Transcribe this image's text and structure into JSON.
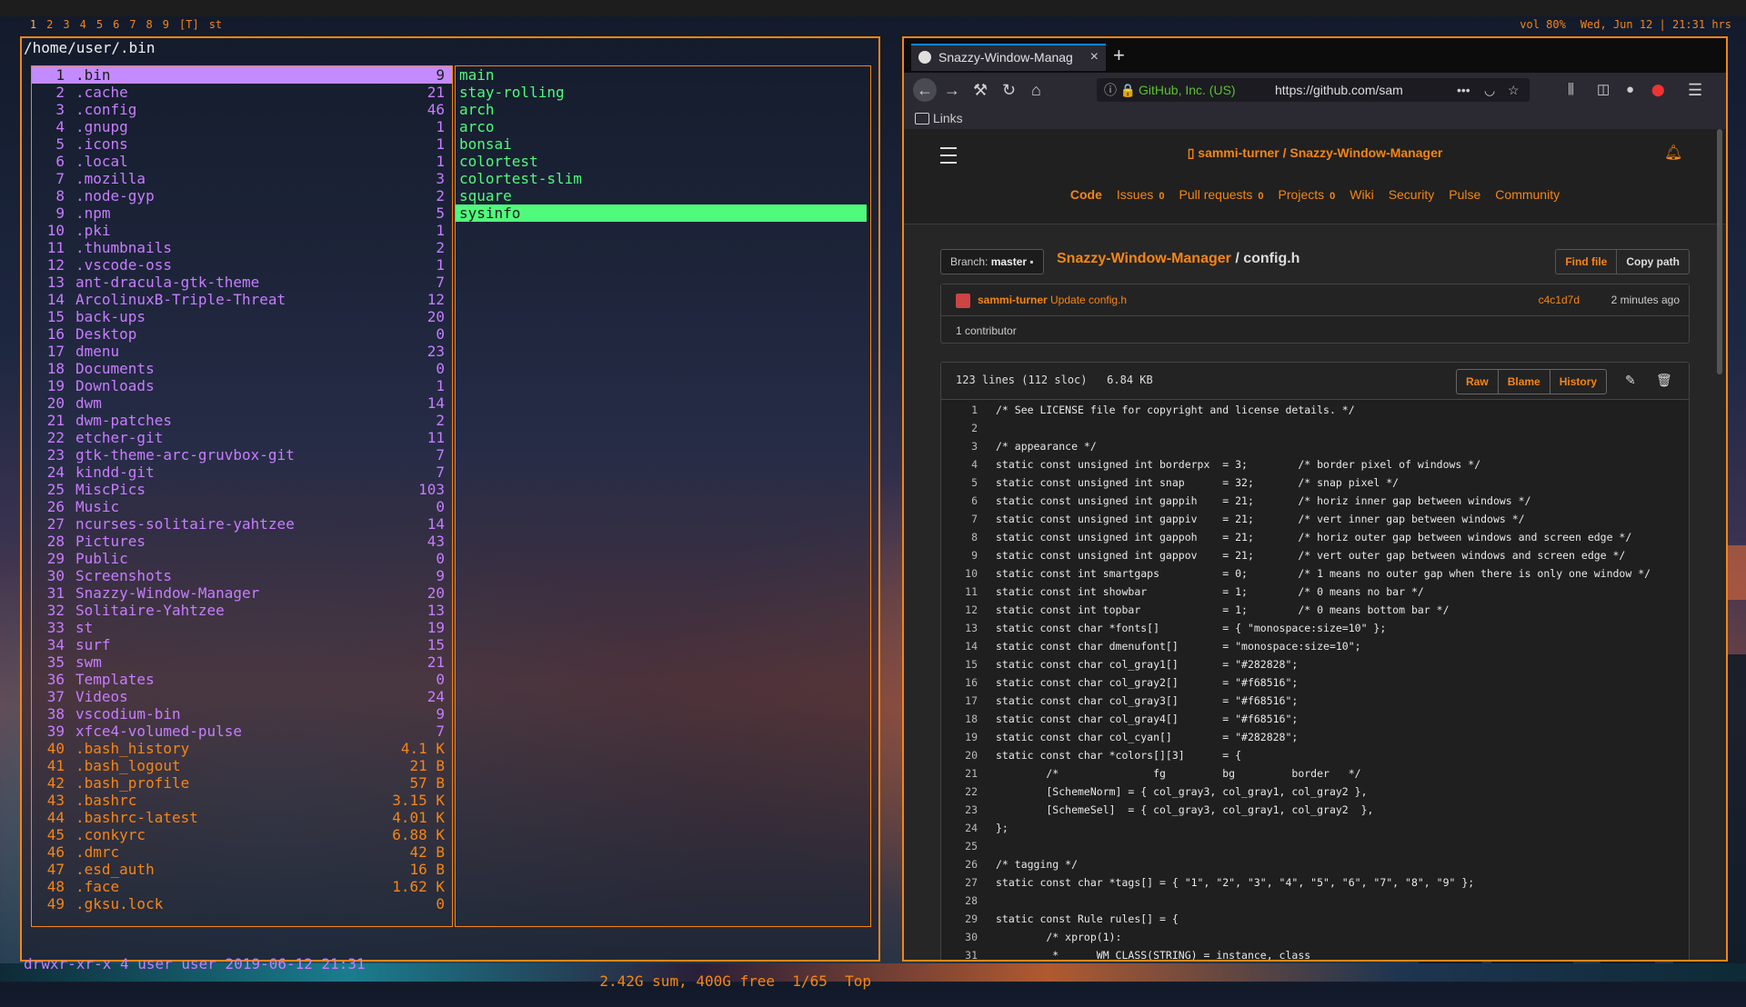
{
  "topbar": {
    "tags": [
      "1",
      "2",
      "3",
      "4",
      "5",
      "6",
      "7",
      "8",
      "9"
    ],
    "layout": "[T]",
    "window": "st",
    "volume": "vol 80%",
    "datetime": "Wed, Jun 12 | 21:31 hrs"
  },
  "terminal": {
    "path": "/home/user/.bin",
    "left_pane": [
      {
        "num": "1",
        "name": ".bin",
        "size": "9",
        "type": "dir",
        "selected": true
      },
      {
        "num": "2",
        "name": ".cache",
        "size": "21",
        "type": "dir"
      },
      {
        "num": "3",
        "name": ".config",
        "size": "46",
        "type": "dir"
      },
      {
        "num": "4",
        "name": ".gnupg",
        "size": "1",
        "type": "dir"
      },
      {
        "num": "5",
        "name": ".icons",
        "size": "1",
        "type": "dir"
      },
      {
        "num": "6",
        "name": ".local",
        "size": "1",
        "type": "dir"
      },
      {
        "num": "7",
        "name": ".mozilla",
        "size": "3",
        "type": "dir"
      },
      {
        "num": "8",
        "name": ".node-gyp",
        "size": "2",
        "type": "dir"
      },
      {
        "num": "9",
        "name": ".npm",
        "size": "5",
        "type": "dir"
      },
      {
        "num": "10",
        "name": ".pki",
        "size": "1",
        "type": "dir"
      },
      {
        "num": "11",
        "name": ".thumbnails",
        "size": "2",
        "type": "dir"
      },
      {
        "num": "12",
        "name": ".vscode-oss",
        "size": "1",
        "type": "dir"
      },
      {
        "num": "13",
        "name": "ant-dracula-gtk-theme",
        "size": "7",
        "type": "dir"
      },
      {
        "num": "14",
        "name": "ArcolinuxB-Triple-Threat",
        "size": "12",
        "type": "dir"
      },
      {
        "num": "15",
        "name": "back-ups",
        "size": "20",
        "type": "dir"
      },
      {
        "num": "16",
        "name": "Desktop",
        "size": "0",
        "type": "dir"
      },
      {
        "num": "17",
        "name": "dmenu",
        "size": "23",
        "type": "dir"
      },
      {
        "num": "18",
        "name": "Documents",
        "size": "0",
        "type": "dir"
      },
      {
        "num": "19",
        "name": "Downloads",
        "size": "1",
        "type": "dir"
      },
      {
        "num": "20",
        "name": "dwm",
        "size": "14",
        "type": "dir"
      },
      {
        "num": "21",
        "name": "dwm-patches",
        "size": "2",
        "type": "dir"
      },
      {
        "num": "22",
        "name": "etcher-git",
        "size": "11",
        "type": "dir"
      },
      {
        "num": "23",
        "name": "gtk-theme-arc-gruvbox-git",
        "size": "7",
        "type": "dir"
      },
      {
        "num": "24",
        "name": "kindd-git",
        "size": "7",
        "type": "dir"
      },
      {
        "num": "25",
        "name": "MiscPics",
        "size": "103",
        "type": "dir"
      },
      {
        "num": "26",
        "name": "Music",
        "size": "0",
        "type": "dir"
      },
      {
        "num": "27",
        "name": "ncurses-solitaire-yahtzee",
        "size": "14",
        "type": "dir"
      },
      {
        "num": "28",
        "name": "Pictures",
        "size": "43",
        "type": "dir"
      },
      {
        "num": "29",
        "name": "Public",
        "size": "0",
        "type": "dir"
      },
      {
        "num": "30",
        "name": "Screenshots",
        "size": "9",
        "type": "dir"
      },
      {
        "num": "31",
        "name": "Snazzy-Window-Manager",
        "size": "20",
        "type": "dir"
      },
      {
        "num": "32",
        "name": "Solitaire-Yahtzee",
        "size": "13",
        "type": "dir"
      },
      {
        "num": "33",
        "name": "st",
        "size": "19",
        "type": "dir"
      },
      {
        "num": "34",
        "name": "surf",
        "size": "15",
        "type": "dir"
      },
      {
        "num": "35",
        "name": "swm",
        "size": "21",
        "type": "dir"
      },
      {
        "num": "36",
        "name": "Templates",
        "size": "0",
        "type": "dir"
      },
      {
        "num": "37",
        "name": "Videos",
        "size": "24",
        "type": "dir"
      },
      {
        "num": "38",
        "name": "vscodium-bin",
        "size": "9",
        "type": "dir"
      },
      {
        "num": "39",
        "name": "xfce4-volumed-pulse",
        "size": "7",
        "type": "dir"
      },
      {
        "num": "40",
        "name": ".bash_history",
        "size": "4.1 K",
        "type": "file"
      },
      {
        "num": "41",
        "name": ".bash_logout",
        "size": "21 B",
        "type": "file"
      },
      {
        "num": "42",
        "name": ".bash_profile",
        "size": "57 B",
        "type": "file"
      },
      {
        "num": "43",
        "name": ".bashrc",
        "size": "3.15 K",
        "type": "file"
      },
      {
        "num": "44",
        "name": ".bashrc-latest",
        "size": "4.01 K",
        "type": "file"
      },
      {
        "num": "45",
        "name": ".conkyrc",
        "size": "6.88 K",
        "type": "file"
      },
      {
        "num": "46",
        "name": ".dmrc",
        "size": "42 B",
        "type": "file"
      },
      {
        "num": "47",
        "name": ".esd_auth",
        "size": "16 B",
        "type": "file"
      },
      {
        "num": "48",
        "name": ".face",
        "size": "1.62 K",
        "type": "file"
      },
      {
        "num": "49",
        "name": ".gksu.lock",
        "size": "0",
        "type": "file"
      }
    ],
    "right_pane": [
      {
        "name": "main"
      },
      {
        "name": "stay-rolling"
      },
      {
        "name": "arch"
      },
      {
        "name": "arco"
      },
      {
        "name": "bonsai"
      },
      {
        "name": "colortest"
      },
      {
        "name": "colortest-slim"
      },
      {
        "name": "square"
      },
      {
        "name": "sysinfo",
        "selected": true
      }
    ],
    "status_perm": "drwxr-xr-x 4 user user 2019-06-12 21:31",
    "status_info": "2.42G sum, 400G free  1/65  Top"
  },
  "browser": {
    "tab_title": "Snazzy-Window-Manag",
    "tab_close": "×",
    "new_tab": "+",
    "url_org": "GitHub, Inc. (US)",
    "url": "https://github.com/sam",
    "bookmark": "Links",
    "colors": {
      "accent": "#f68516",
      "bg": "#262626",
      "tab_accent": "#0a84ff"
    },
    "github": {
      "owner": "sammi-turner",
      "repo": "Snazzy-Window-Manager",
      "nav": [
        {
          "label": "Code",
          "count": ""
        },
        {
          "label": "Issues",
          "count": "0"
        },
        {
          "label": "Pull requests",
          "count": "0"
        },
        {
          "label": "Projects",
          "count": "0"
        },
        {
          "label": "Wiki",
          "count": ""
        },
        {
          "label": "Security",
          "count": ""
        },
        {
          "label": "Pulse",
          "count": ""
        },
        {
          "label": "Community",
          "count": ""
        }
      ],
      "branch_label": "Branch:",
      "branch": "master",
      "crumb_repo": "Snazzy-Window-Manager",
      "crumb_sep": "/",
      "crumb_file": "config.h",
      "find_file": "Find file",
      "copy_path": "Copy path",
      "commit_author": "sammi-turner",
      "commit_msg": "Update config.h",
      "commit_sha": "c4c1d7d",
      "commit_time": "2 minutes ago",
      "contributors": "1 contributor",
      "file_meta": "123 lines (112 sloc)   6.84 KB",
      "raw": "Raw",
      "blame": "Blame",
      "history": "History",
      "code": [
        {
          "n": "1",
          "t": "/* See LICENSE file for copyright and license details. */"
        },
        {
          "n": "2",
          "t": ""
        },
        {
          "n": "3",
          "t": "/* appearance */"
        },
        {
          "n": "4",
          "t": "static const unsigned int borderpx  = 3;        /* border pixel of windows */"
        },
        {
          "n": "5",
          "t": "static const unsigned int snap      = 32;       /* snap pixel */"
        },
        {
          "n": "6",
          "t": "static const unsigned int gappih    = 21;       /* horiz inner gap between windows */"
        },
        {
          "n": "7",
          "t": "static const unsigned int gappiv    = 21;       /* vert inner gap between windows */"
        },
        {
          "n": "8",
          "t": "static const unsigned int gappoh    = 21;       /* horiz outer gap between windows and screen edge */"
        },
        {
          "n": "9",
          "t": "static const unsigned int gappov    = 21;       /* vert outer gap between windows and screen edge */"
        },
        {
          "n": "10",
          "t": "static const int smartgaps          = 0;        /* 1 means no outer gap when there is only one window */"
        },
        {
          "n": "11",
          "t": "static const int showbar            = 1;        /* 0 means no bar */"
        },
        {
          "n": "12",
          "t": "static const int topbar             = 1;        /* 0 means bottom bar */"
        },
        {
          "n": "13",
          "t": "static const char *fonts[]          = { \"monospace:size=10\" };"
        },
        {
          "n": "14",
          "t": "static const char dmenufont[]       = \"monospace:size=10\";"
        },
        {
          "n": "15",
          "t": "static const char col_gray1[]       = \"#282828\";"
        },
        {
          "n": "16",
          "t": "static const char col_gray2[]       = \"#f68516\";"
        },
        {
          "n": "17",
          "t": "static const char col_gray3[]       = \"#f68516\";"
        },
        {
          "n": "18",
          "t": "static const char col_gray4[]       = \"#f68516\";"
        },
        {
          "n": "19",
          "t": "static const char col_cyan[]        = \"#282828\";"
        },
        {
          "n": "20",
          "t": "static const char *colors[][3]      = {"
        },
        {
          "n": "21",
          "t": "        /*               fg         bg         border   */"
        },
        {
          "n": "22",
          "t": "        [SchemeNorm] = { col_gray3, col_gray1, col_gray2 },"
        },
        {
          "n": "23",
          "t": "        [SchemeSel]  = { col_gray3, col_gray1, col_gray2  },"
        },
        {
          "n": "24",
          "t": "};"
        },
        {
          "n": "25",
          "t": ""
        },
        {
          "n": "26",
          "t": "/* tagging */"
        },
        {
          "n": "27",
          "t": "static const char *tags[] = { \"1\", \"2\", \"3\", \"4\", \"5\", \"6\", \"7\", \"8\", \"9\" };"
        },
        {
          "n": "28",
          "t": ""
        },
        {
          "n": "29",
          "t": "static const Rule rules[] = {"
        },
        {
          "n": "30",
          "t": "        /* xprop(1):"
        },
        {
          "n": "31",
          "t": "         *      WM_CLASS(STRING) = instance, class"
        }
      ]
    }
  }
}
